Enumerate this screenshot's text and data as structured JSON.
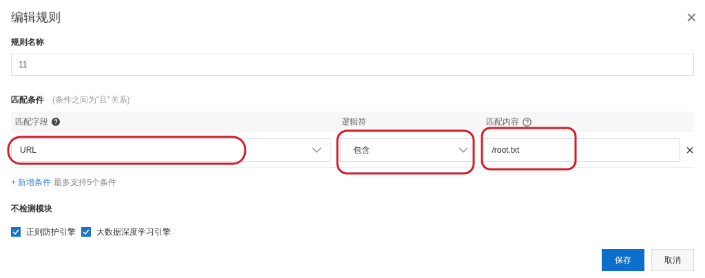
{
  "dialog": {
    "title": "编辑规则",
    "close": "×"
  },
  "rule_name": {
    "label": "规则名称",
    "value": "11"
  },
  "conditions": {
    "label": "匹配条件",
    "hint": "(条件之间为\"且\"关系)",
    "columns": [
      {
        "label": "匹配字段",
        "help": true
      },
      {
        "label": "逻辑符",
        "help": false
      },
      {
        "label": "匹配内容",
        "help": true
      }
    ],
    "rows": [
      {
        "field": "URL",
        "operator": "包含",
        "value": "/root.txt",
        "remove": "×"
      }
    ],
    "add_link": "+ 新增条件",
    "limit_note": "最多支持5个条件"
  },
  "exclude_modules": {
    "label": "不检测模块",
    "options": [
      {
        "label": "正则防护引擎",
        "checked": true
      },
      {
        "label": "大数据深度学习引擎",
        "checked": true
      }
    ]
  },
  "buttons": [
    {
      "label": "保存",
      "kind": "primary"
    },
    {
      "label": "取消",
      "kind": "secondary"
    }
  ]
}
